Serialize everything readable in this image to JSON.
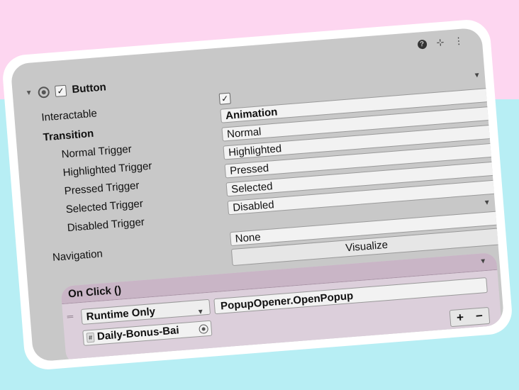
{
  "colors": {
    "panel": "#c8c8c8",
    "event_bg": "#dccfdb",
    "bg_pink": "#fdd6f0",
    "bg_cyan": "#b7eef4"
  },
  "header_icons": [
    "help-icon",
    "preset-sliders-icon",
    "more-vertical-icon"
  ],
  "component": {
    "fold_icon": "▼",
    "enabled_check": "✓",
    "title": "Button"
  },
  "props": {
    "interactable": {
      "label": "Interactable",
      "checked": "✓"
    },
    "transition": {
      "label": "Transition",
      "value": "Animation"
    },
    "normal": {
      "label": "Normal Trigger",
      "value": "Normal"
    },
    "highlighted": {
      "label": "Highlighted Trigger",
      "value": "Highlighted"
    },
    "pressed": {
      "label": "Pressed Trigger",
      "value": "Pressed"
    },
    "selected": {
      "label": "Selected Trigger",
      "value": "Selected"
    },
    "disabled": {
      "label": "Disabled Trigger",
      "value": "Disabled"
    },
    "navigation": {
      "label": "Navigation",
      "value": "None",
      "visualize": "Visualize"
    }
  },
  "on_click": {
    "title": "On Click ()",
    "runtime": "Runtime Only",
    "function": "PopupOpener.OpenPopup",
    "object": "Daily-Bonus-Bai",
    "hash": "#",
    "plus": "+",
    "minus": "−"
  },
  "glyphs": {
    "help": "?",
    "sliders": "⊹",
    "more": "⋮",
    "drag": "═",
    "dd": "▼"
  }
}
